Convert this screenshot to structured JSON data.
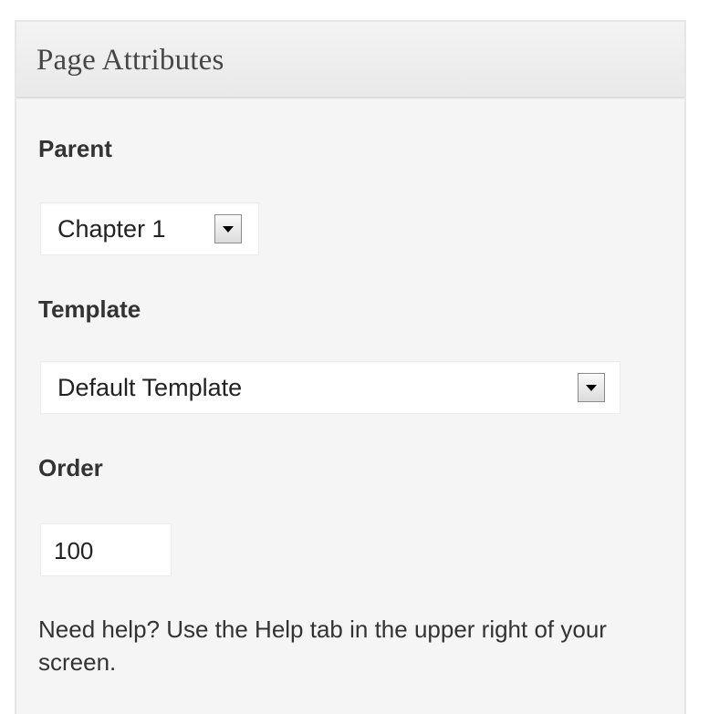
{
  "panel": {
    "title": "Page Attributes"
  },
  "parent": {
    "label": "Parent",
    "selected": "Chapter 1"
  },
  "template": {
    "label": "Template",
    "selected": "Default Template"
  },
  "order": {
    "label": "Order",
    "value": "100"
  },
  "help": {
    "text": "Need help? Use the Help tab in the upper right of your screen."
  },
  "icons": {
    "dropdown": "chevron-down-icon"
  },
  "colors": {
    "panel_bg": "#f5f5f5",
    "header_bg": "#e9e9e9",
    "text": "#333333",
    "title": "#464646"
  }
}
